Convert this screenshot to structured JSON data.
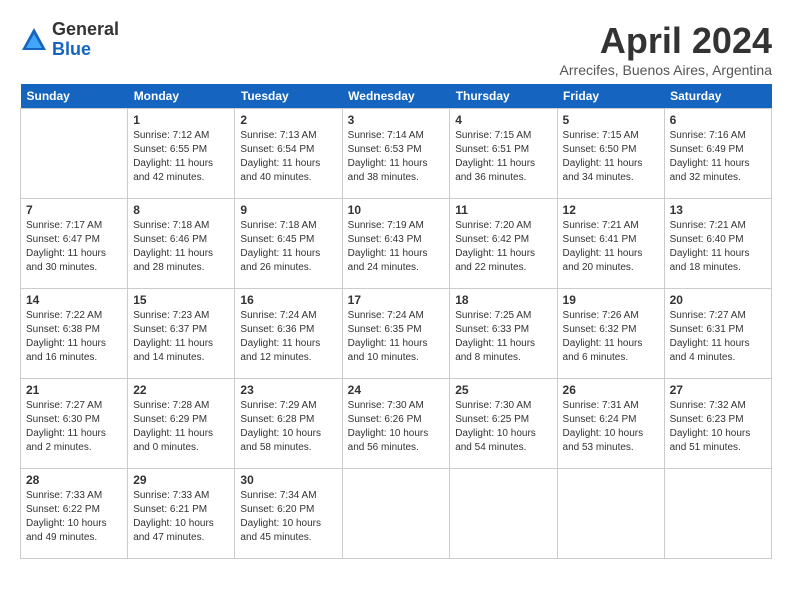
{
  "logo": {
    "general": "General",
    "blue": "Blue"
  },
  "header": {
    "month": "April 2024",
    "location": "Arrecifes, Buenos Aires, Argentina"
  },
  "weekdays": [
    "Sunday",
    "Monday",
    "Tuesday",
    "Wednesday",
    "Thursday",
    "Friday",
    "Saturday"
  ],
  "weeks": [
    [
      {
        "day": "",
        "info": ""
      },
      {
        "day": "1",
        "info": "Sunrise: 7:12 AM\nSunset: 6:55 PM\nDaylight: 11 hours\nand 42 minutes."
      },
      {
        "day": "2",
        "info": "Sunrise: 7:13 AM\nSunset: 6:54 PM\nDaylight: 11 hours\nand 40 minutes."
      },
      {
        "day": "3",
        "info": "Sunrise: 7:14 AM\nSunset: 6:53 PM\nDaylight: 11 hours\nand 38 minutes."
      },
      {
        "day": "4",
        "info": "Sunrise: 7:15 AM\nSunset: 6:51 PM\nDaylight: 11 hours\nand 36 minutes."
      },
      {
        "day": "5",
        "info": "Sunrise: 7:15 AM\nSunset: 6:50 PM\nDaylight: 11 hours\nand 34 minutes."
      },
      {
        "day": "6",
        "info": "Sunrise: 7:16 AM\nSunset: 6:49 PM\nDaylight: 11 hours\nand 32 minutes."
      }
    ],
    [
      {
        "day": "7",
        "info": "Sunrise: 7:17 AM\nSunset: 6:47 PM\nDaylight: 11 hours\nand 30 minutes."
      },
      {
        "day": "8",
        "info": "Sunrise: 7:18 AM\nSunset: 6:46 PM\nDaylight: 11 hours\nand 28 minutes."
      },
      {
        "day": "9",
        "info": "Sunrise: 7:18 AM\nSunset: 6:45 PM\nDaylight: 11 hours\nand 26 minutes."
      },
      {
        "day": "10",
        "info": "Sunrise: 7:19 AM\nSunset: 6:43 PM\nDaylight: 11 hours\nand 24 minutes."
      },
      {
        "day": "11",
        "info": "Sunrise: 7:20 AM\nSunset: 6:42 PM\nDaylight: 11 hours\nand 22 minutes."
      },
      {
        "day": "12",
        "info": "Sunrise: 7:21 AM\nSunset: 6:41 PM\nDaylight: 11 hours\nand 20 minutes."
      },
      {
        "day": "13",
        "info": "Sunrise: 7:21 AM\nSunset: 6:40 PM\nDaylight: 11 hours\nand 18 minutes."
      }
    ],
    [
      {
        "day": "14",
        "info": "Sunrise: 7:22 AM\nSunset: 6:38 PM\nDaylight: 11 hours\nand 16 minutes."
      },
      {
        "day": "15",
        "info": "Sunrise: 7:23 AM\nSunset: 6:37 PM\nDaylight: 11 hours\nand 14 minutes."
      },
      {
        "day": "16",
        "info": "Sunrise: 7:24 AM\nSunset: 6:36 PM\nDaylight: 11 hours\nand 12 minutes."
      },
      {
        "day": "17",
        "info": "Sunrise: 7:24 AM\nSunset: 6:35 PM\nDaylight: 11 hours\nand 10 minutes."
      },
      {
        "day": "18",
        "info": "Sunrise: 7:25 AM\nSunset: 6:33 PM\nDaylight: 11 hours\nand 8 minutes."
      },
      {
        "day": "19",
        "info": "Sunrise: 7:26 AM\nSunset: 6:32 PM\nDaylight: 11 hours\nand 6 minutes."
      },
      {
        "day": "20",
        "info": "Sunrise: 7:27 AM\nSunset: 6:31 PM\nDaylight: 11 hours\nand 4 minutes."
      }
    ],
    [
      {
        "day": "21",
        "info": "Sunrise: 7:27 AM\nSunset: 6:30 PM\nDaylight: 11 hours\nand 2 minutes."
      },
      {
        "day": "22",
        "info": "Sunrise: 7:28 AM\nSunset: 6:29 PM\nDaylight: 11 hours\nand 0 minutes."
      },
      {
        "day": "23",
        "info": "Sunrise: 7:29 AM\nSunset: 6:28 PM\nDaylight: 10 hours\nand 58 minutes."
      },
      {
        "day": "24",
        "info": "Sunrise: 7:30 AM\nSunset: 6:26 PM\nDaylight: 10 hours\nand 56 minutes."
      },
      {
        "day": "25",
        "info": "Sunrise: 7:30 AM\nSunset: 6:25 PM\nDaylight: 10 hours\nand 54 minutes."
      },
      {
        "day": "26",
        "info": "Sunrise: 7:31 AM\nSunset: 6:24 PM\nDaylight: 10 hours\nand 53 minutes."
      },
      {
        "day": "27",
        "info": "Sunrise: 7:32 AM\nSunset: 6:23 PM\nDaylight: 10 hours\nand 51 minutes."
      }
    ],
    [
      {
        "day": "28",
        "info": "Sunrise: 7:33 AM\nSunset: 6:22 PM\nDaylight: 10 hours\nand 49 minutes."
      },
      {
        "day": "29",
        "info": "Sunrise: 7:33 AM\nSunset: 6:21 PM\nDaylight: 10 hours\nand 47 minutes."
      },
      {
        "day": "30",
        "info": "Sunrise: 7:34 AM\nSunset: 6:20 PM\nDaylight: 10 hours\nand 45 minutes."
      },
      {
        "day": "",
        "info": ""
      },
      {
        "day": "",
        "info": ""
      },
      {
        "day": "",
        "info": ""
      },
      {
        "day": "",
        "info": ""
      }
    ]
  ]
}
